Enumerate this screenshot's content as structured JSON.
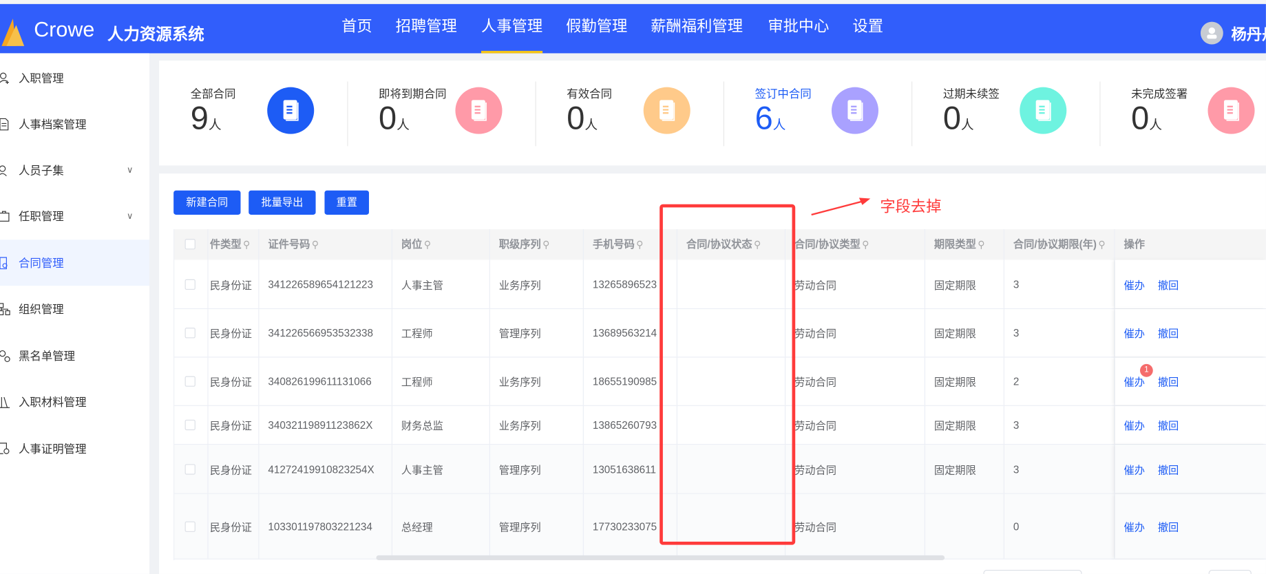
{
  "header": {
    "brand": "Crowe",
    "system_title": "人力资源系统",
    "nav": [
      "首页",
      "招聘管理",
      "人事管理",
      "假勤管理",
      "薪酬福利管理",
      "审批中心",
      "设置"
    ],
    "active_nav": "人事管理",
    "user_name": "杨丹丹"
  },
  "sidebar": {
    "items": [
      {
        "label": "入职管理",
        "icon": "user-add-icon"
      },
      {
        "label": "人事档案管理",
        "icon": "document-icon"
      },
      {
        "label": "人员子集",
        "icon": "users-icon",
        "expandable": true
      },
      {
        "label": "任职管理",
        "icon": "briefcase-icon",
        "expandable": true
      },
      {
        "label": "合同管理",
        "icon": "contract-icon",
        "active": true
      },
      {
        "label": "组织管理",
        "icon": "org-chart-icon"
      },
      {
        "label": "黑名单管理",
        "icon": "user-block-icon"
      },
      {
        "label": "入职材料管理",
        "icon": "books-icon"
      },
      {
        "label": "人事证明管理",
        "icon": "certificate-icon"
      }
    ]
  },
  "stats": [
    {
      "label": "全部合同",
      "value": "9",
      "unit": "人",
      "color": "#1d5cf5"
    },
    {
      "label": "即将到期合同",
      "value": "0",
      "unit": "人",
      "color": "#ff9aa8"
    },
    {
      "label": "有效合同",
      "value": "0",
      "unit": "人",
      "color": "#ffca8a"
    },
    {
      "label": "签订中合同",
      "value": "6",
      "unit": "人",
      "color": "#a9a1ff"
    },
    {
      "label": "过期未续签",
      "value": "0",
      "unit": "人",
      "color": "#6ef3e0"
    },
    {
      "label": "未完成签署",
      "value": "0",
      "unit": "人",
      "color": "#ff9aa8"
    }
  ],
  "toolbar": {
    "new": "新建合同",
    "export": "批量导出",
    "reset": "重置"
  },
  "table": {
    "columns": [
      "件类型",
      "证件号码",
      "岗位",
      "职级序列",
      "手机号码",
      "合同/协议状态",
      "合同/协议类型",
      "期限类型",
      "合同/协议期限(年)",
      "操作"
    ],
    "rows": [
      [
        "民身份证",
        "341226589654121223",
        "人事主管",
        "业务序列",
        "13265896523",
        "",
        "劳动合同",
        "固定期限",
        "3"
      ],
      [
        "民身份证",
        "341226566953532338",
        "工程师",
        "管理序列",
        "13689563214",
        "",
        "劳动合同",
        "固定期限",
        "3"
      ],
      [
        "民身份证",
        "340826199611131066",
        "工程师",
        "业务序列",
        "18655190985",
        "",
        "劳动合同",
        "固定期限",
        "2"
      ],
      [
        "民身份证",
        "34032119891123862X",
        "财务总监",
        "业务序列",
        "13865260793",
        "",
        "劳动合同",
        "固定期限",
        "3"
      ],
      [
        "民身份证",
        "41272419910823254X",
        "人事主管",
        "管理序列",
        "13051638611",
        "",
        "劳动合同",
        "固定期限",
        "3"
      ],
      [
        "民身份证",
        "103301197803221234",
        "总经理",
        "管理序列",
        "17730233075",
        "",
        "劳动合同",
        "",
        "0"
      ]
    ],
    "actions": {
      "urge": "催办",
      "withdraw": "撤回"
    },
    "badge_row": 2,
    "badge_count": "1"
  },
  "annotation": {
    "text": "字段去掉",
    "color": "#ff3b3b"
  }
}
